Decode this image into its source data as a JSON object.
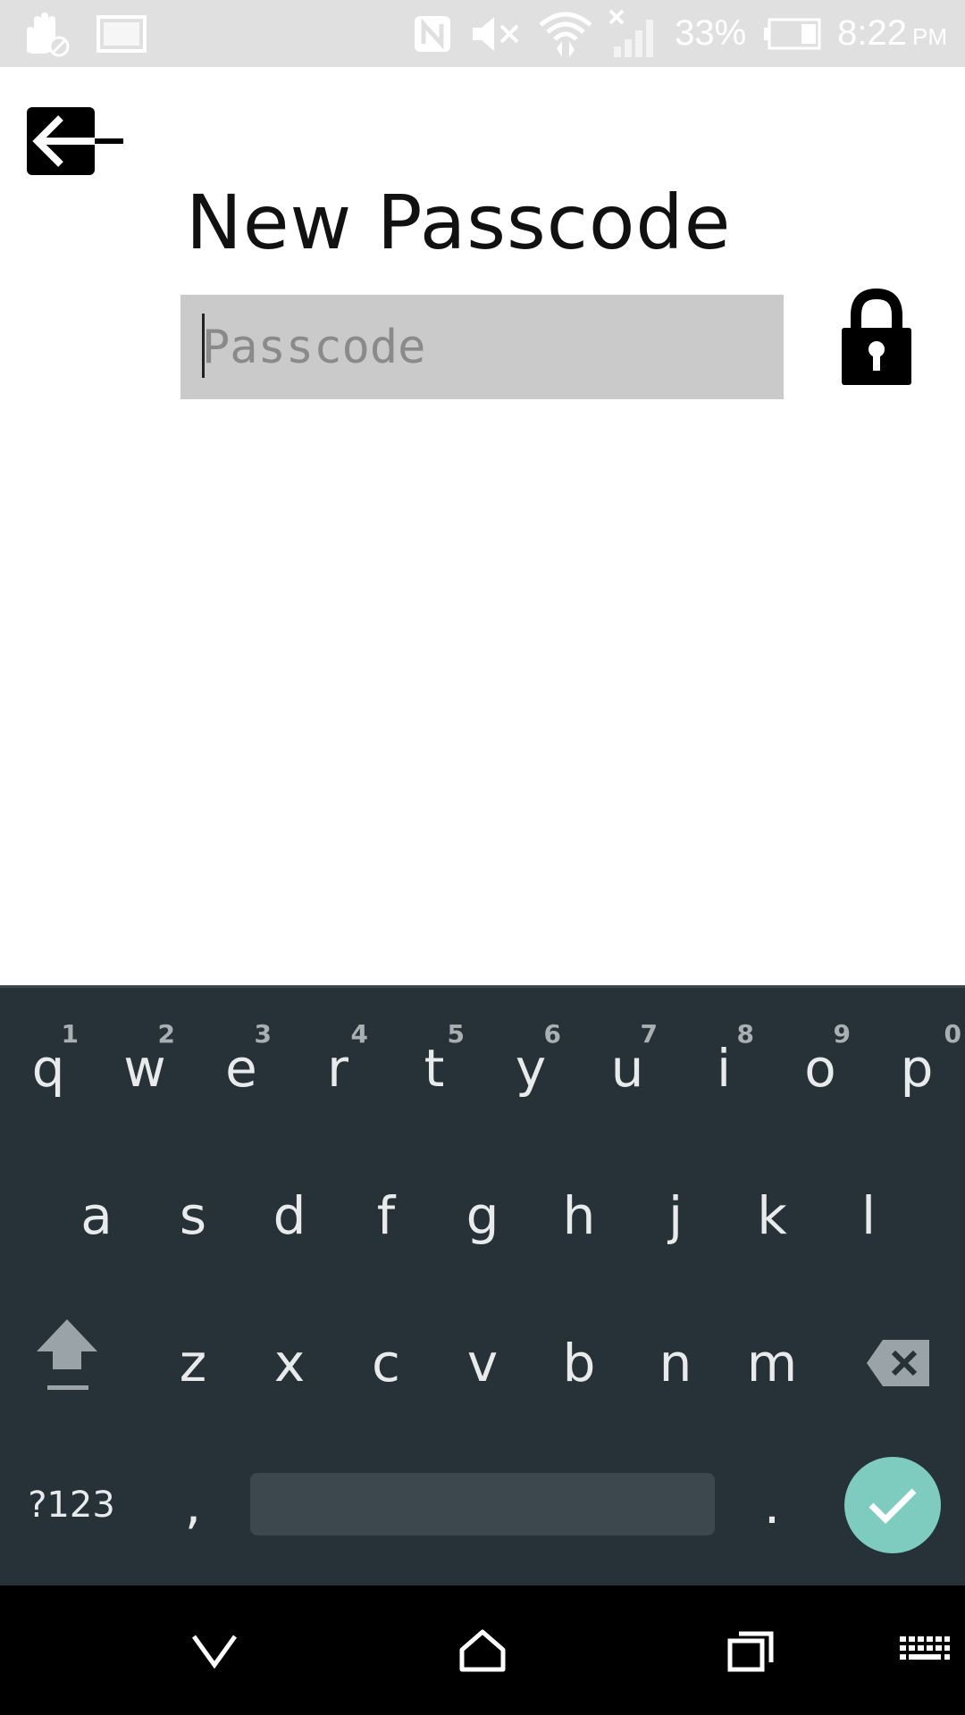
{
  "status_bar": {
    "battery_percent": "33%",
    "time": "8:22",
    "ampm": "PM",
    "icons": [
      "hand-block-icon",
      "screenshot-icon",
      "nfc-icon",
      "mute-icon",
      "wifi-icon",
      "no-signal-icon",
      "battery-icon"
    ]
  },
  "app": {
    "back_icon": "back-arrow-icon",
    "title": "New Passcode",
    "passcode_input": {
      "placeholder": "Passcode",
      "value": ""
    },
    "lock_icon": "lock-icon"
  },
  "keyboard": {
    "row1": [
      {
        "key": "q",
        "hint": "1"
      },
      {
        "key": "w",
        "hint": "2"
      },
      {
        "key": "e",
        "hint": "3"
      },
      {
        "key": "r",
        "hint": "4"
      },
      {
        "key": "t",
        "hint": "5"
      },
      {
        "key": "y",
        "hint": "6"
      },
      {
        "key": "u",
        "hint": "7"
      },
      {
        "key": "i",
        "hint": "8"
      },
      {
        "key": "o",
        "hint": "9"
      },
      {
        "key": "p",
        "hint": "0"
      }
    ],
    "row2": [
      "a",
      "s",
      "d",
      "f",
      "g",
      "h",
      "j",
      "k",
      "l"
    ],
    "row3": [
      "z",
      "x",
      "c",
      "v",
      "b",
      "n",
      "m"
    ],
    "symbols_key": "?123",
    "comma_key": ",",
    "period_key": ".",
    "shift_icon": "shift-icon",
    "backspace_icon": "backspace-icon",
    "enter_icon": "checkmark-icon",
    "accent_color": "#7ecbc0",
    "background_color": "#263238"
  },
  "nav_bar": {
    "icons": [
      "nav-back-icon",
      "nav-home-icon",
      "nav-recents-icon",
      "keyboard-switch-icon"
    ]
  }
}
